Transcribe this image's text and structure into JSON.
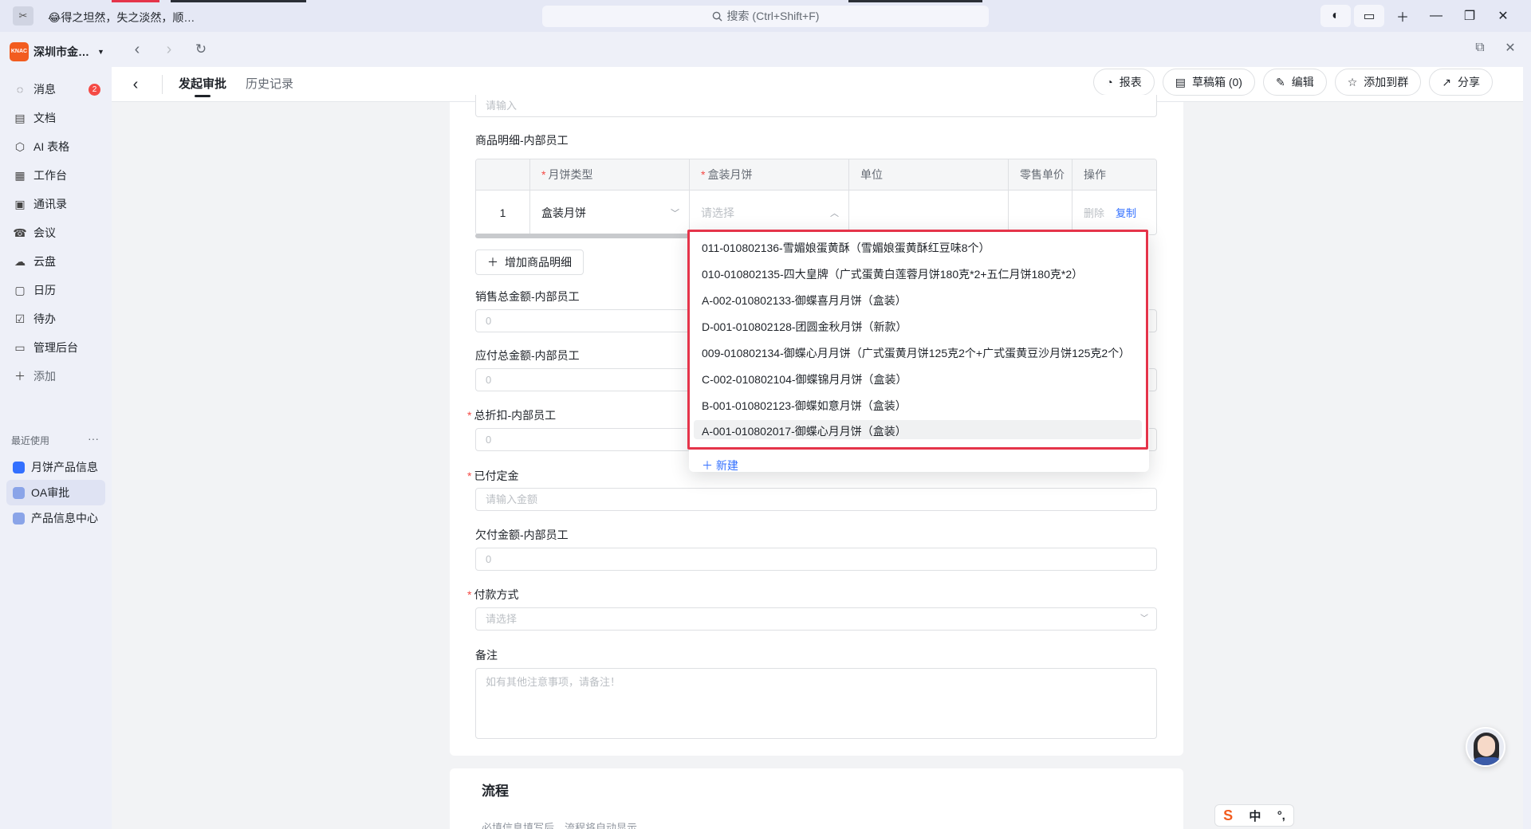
{
  "titlebar": {
    "app_glyph": "✂",
    "status": "😂得之坦然，失之淡然，顺…",
    "search": "搜索 (Ctrl+Shift+F)"
  },
  "sidebar": {
    "org": "深圳市金…",
    "items": [
      {
        "label": "消息",
        "icon": "chat-icon",
        "badge": "2"
      },
      {
        "label": "文档",
        "icon": "doc-icon"
      },
      {
        "label": "AI 表格",
        "icon": "ai-table-icon"
      },
      {
        "label": "工作台",
        "icon": "grid-icon"
      },
      {
        "label": "通讯录",
        "icon": "contacts-icon"
      },
      {
        "label": "会议",
        "icon": "meeting-icon"
      },
      {
        "label": "云盘",
        "icon": "cloud-icon"
      },
      {
        "label": "日历",
        "icon": "calendar-icon"
      },
      {
        "label": "待办",
        "icon": "todo-icon"
      },
      {
        "label": "管理后台",
        "icon": "admin-icon"
      },
      {
        "label": "添加",
        "icon": "plus-icon"
      }
    ],
    "recent_title": "最近使用",
    "recent": [
      {
        "label": "月饼产品信息",
        "color": "#3370ff"
      },
      {
        "label": "OA审批",
        "color": "#8aa4e8"
      },
      {
        "label": "产品信息中心",
        "color": "#8aa4e8"
      }
    ],
    "more": "更多"
  },
  "header": {
    "tabs": [
      "发起审批",
      "历史记录"
    ],
    "actions": [
      {
        "label": "报表",
        "icon": "chart-icon"
      },
      {
        "label": "草稿箱 (0)",
        "icon": "drafts-icon"
      },
      {
        "label": "编辑",
        "icon": "edit-icon"
      },
      {
        "label": "添加到群",
        "icon": "pin-icon"
      },
      {
        "label": "分享",
        "icon": "share-icon"
      }
    ]
  },
  "form": {
    "top_placeholder": "请输入",
    "detail_title": "商品明细-内部员工",
    "table": {
      "headers": [
        "",
        "月饼类型",
        "盒装月饼",
        "单位",
        "零售单价",
        "操作"
      ],
      "row": {
        "index": "1",
        "type": "盒装月饼",
        "box_placeholder": "请选择",
        "unit": "",
        "price": "",
        "delete": "删除",
        "copy": "复制"
      }
    },
    "add_detail": "增加商品明细",
    "fields": [
      {
        "label": "销售总金额-内部员工",
        "required": false,
        "value": "0"
      },
      {
        "label": "应付总金额-内部员工",
        "required": false,
        "value": "0"
      },
      {
        "label": "总折扣-内部员工",
        "required": true,
        "value": "0"
      },
      {
        "label": "已付定金",
        "required": true,
        "value": "请输入金额"
      },
      {
        "label": "欠付金额-内部员工",
        "required": false,
        "value": "0"
      },
      {
        "label": "付款方式",
        "required": true,
        "value": "请选择"
      }
    ],
    "remark_label": "备注",
    "remark_placeholder": "如有其他注意事项，请备注！"
  },
  "dropdown": {
    "options": [
      "011-010802136-雪媚娘蛋黄酥（雪媚娘蛋黄酥红豆味8个）",
      "010-010802135-四大皇牌（广式蛋黄白莲蓉月饼180克*2+五仁月饼180克*2）",
      "A-002-010802133-御蝶喜月月饼（盒装）",
      "D-001-010802128-团圆金秋月饼（新款）",
      "009-010802134-御蝶心月月饼（广式蛋黄月饼125克2个+广式蛋黄豆沙月饼125克2个）",
      "C-002-010802104-御蝶锦月月饼（盒装）",
      "B-001-010802123-御蝶如意月饼（盒装）",
      "A-001-010802017-御蝶心月月饼（盒装）"
    ],
    "new_label": "新建"
  },
  "flow": {
    "title": "流程",
    "subtitle": "必填信息填写后，流程将自动显示"
  },
  "ime": {
    "logo": "S",
    "mode": "中",
    "punct": "°,"
  }
}
